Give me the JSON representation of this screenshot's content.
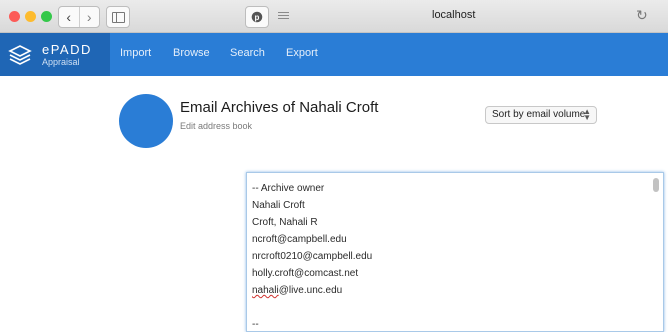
{
  "browser": {
    "url": "localhost",
    "traffic_light_colors": [
      "#fc5b57",
      "#fdbb2e",
      "#34c84a"
    ],
    "icons": [
      "back-arrow-icon",
      "forward-arrow-icon",
      "sidebar-icon",
      "pinterest-icon",
      "reader-icon",
      "reload-icon"
    ]
  },
  "app": {
    "logo_name": "ePADD",
    "logo_sub": "Appraisal",
    "brand_color": "#2a7dd6",
    "menu": [
      "Import",
      "Browse",
      "Search",
      "Export"
    ]
  },
  "page": {
    "title": "Email Archives of Nahali Croft",
    "edit_link": "Edit address book",
    "sort_select": "Sort by email volume"
  },
  "address_book_lines": [
    "-- Archive owner",
    "Nahali Croft",
    "Croft, Nahali R",
    "ncroft@campbell.edu",
    "nrcroft0210@campbell.edu",
    "holly.croft@comcast.net",
    "nahali@live.unc.edu",
    "",
    "--"
  ],
  "address_book_prefix": "nahali",
  "address_book_suffix": "@live.unc.edu"
}
